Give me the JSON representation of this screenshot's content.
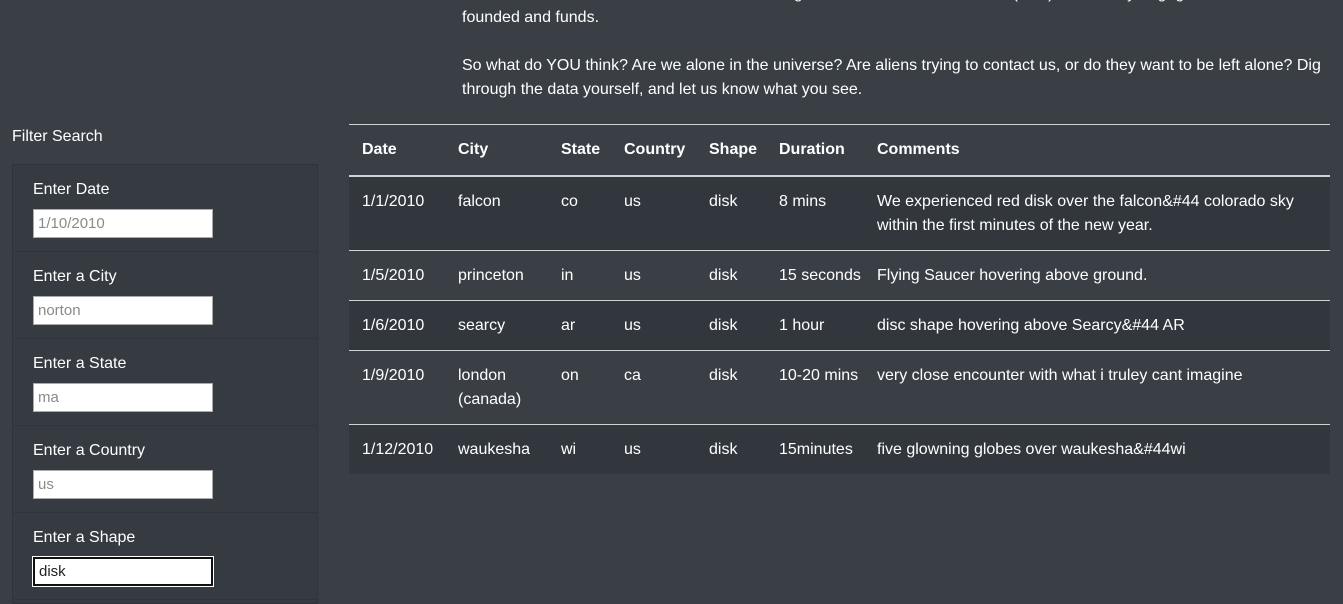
{
  "intro": {
    "paragraph1": "like to be left alone,” she stated, before directing us to the Leave Aliens Alone (LAA) community engagement initiative she founded and funds.",
    "paragraph2": "So what do YOU think? Are we alone in the universe? Are aliens trying to contact us, or do they want to be left alone? Dig through the data yourself, and let us know what you see."
  },
  "filters": {
    "title": "Filter Search",
    "date": {
      "label": "Enter Date",
      "placeholder": "1/10/2010",
      "value": ""
    },
    "city": {
      "label": "Enter a City",
      "placeholder": "norton",
      "value": ""
    },
    "state": {
      "label": "Enter a State",
      "placeholder": "ma",
      "value": ""
    },
    "country": {
      "label": "Enter a Country",
      "placeholder": "us",
      "value": ""
    },
    "shape": {
      "label": "Enter a Shape",
      "placeholder": "",
      "value": "disk"
    }
  },
  "table": {
    "headers": [
      "Date",
      "City",
      "State",
      "Country",
      "Shape",
      "Duration",
      "Comments"
    ],
    "rows": [
      [
        "1/1/2010",
        "falcon",
        "co",
        "us",
        "disk",
        "8 mins",
        "We experienced red disk over the falcon&#44 colorado sky within the first minutes of the new year."
      ],
      [
        "1/5/2010",
        "princeton",
        "in",
        "us",
        "disk",
        "15 seconds",
        "Flying Saucer hovering above ground."
      ],
      [
        "1/6/2010",
        "searcy",
        "ar",
        "us",
        "disk",
        "1 hour",
        "disc shape hovering above Searcy&#44 AR"
      ],
      [
        "1/9/2010",
        "london (canada)",
        "on",
        "ca",
        "disk",
        "10-20 mins",
        "very close encounter with what i truley cant imagine"
      ],
      [
        "1/12/2010",
        "waukesha",
        "wi",
        "us",
        "disk",
        "15minutes",
        "five glowning globes over waukesha&#44wi"
      ]
    ]
  }
}
